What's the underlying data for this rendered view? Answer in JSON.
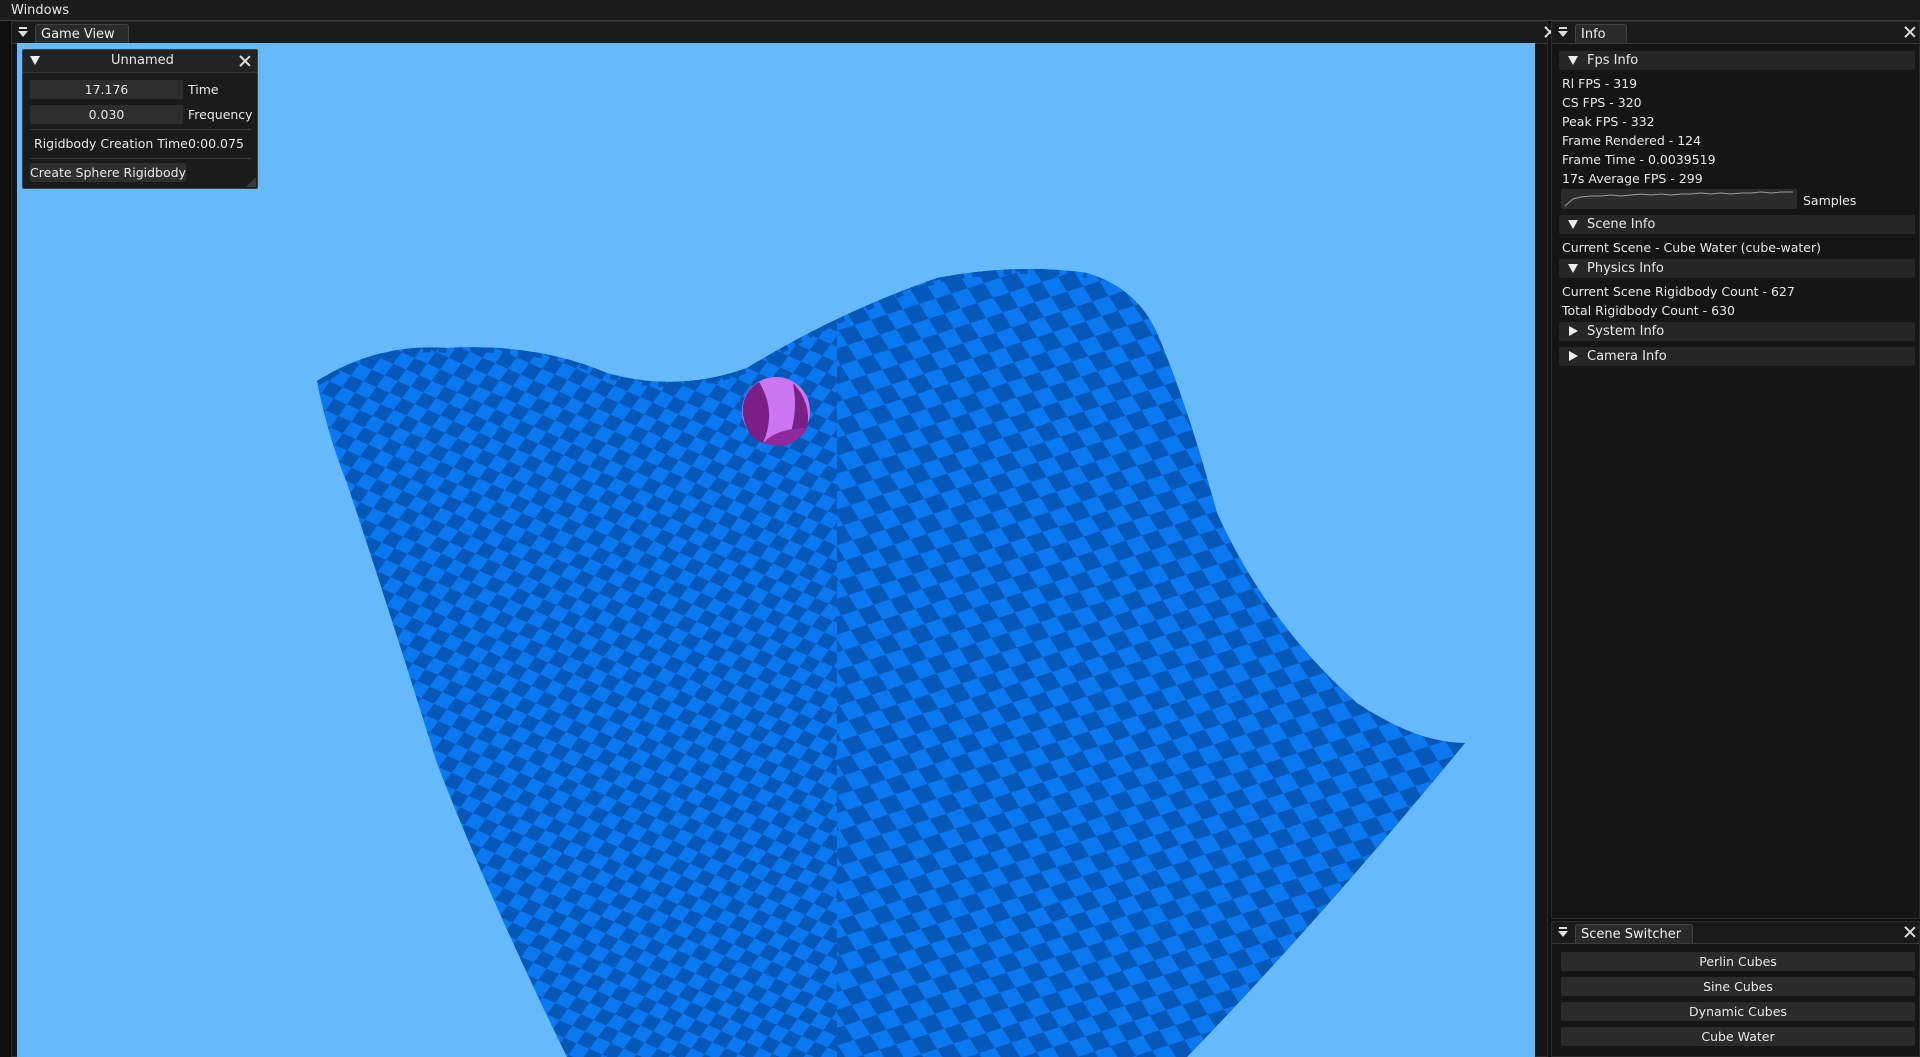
{
  "menubar": {
    "label": "Windows"
  },
  "game_view": {
    "tab_label": "Game View"
  },
  "unnamed_window": {
    "title": "Unnamed",
    "time_value": "17.176",
    "time_label": "Time",
    "frequency_value": "0.030",
    "frequency_label": "Frequency",
    "rigidbody_creation_label": "Rigidbody Creation Time",
    "rigidbody_creation_value": "0:00.075",
    "create_sphere_button": "Create Sphere Rigidbody"
  },
  "info_panel": {
    "tab_label": "Info",
    "fps_section": "Fps Info",
    "fps_lines": [
      "Rl FPS - 319",
      "CS FPS - 320",
      "Peak FPS - 332",
      "Frame Rendered - 124",
      "Frame Time - 0.0039519",
      "17s Average FPS - 299"
    ],
    "samples_label": "Samples",
    "scene_section": "Scene Info",
    "scene_lines": [
      "Current Scene - Cube Water (cube-water)"
    ],
    "physics_section": "Physics Info",
    "physics_lines": [
      "Current Scene Rigidbody Count - 627",
      "Total Rigidbody Count - 630"
    ],
    "system_section": "System Info",
    "camera_section": "Camera Info"
  },
  "scene_switcher": {
    "tab_label": "Scene Switcher",
    "buttons": [
      "Perlin Cubes",
      "Sine Cubes",
      "Dynamic Cubes",
      "Cube Water"
    ]
  },
  "colors": {
    "sky": "#66b9fb",
    "cube_light": "#0a78f0",
    "cube_dark": "#0558b8",
    "sphere_light": "#cc77f2",
    "sphere_dark": "#7a1f85"
  },
  "icons": {
    "dock_menu": "dock-menu-icon",
    "close": "close-icon",
    "collapse": "triangle-down-icon",
    "expand": "triangle-right-icon"
  }
}
